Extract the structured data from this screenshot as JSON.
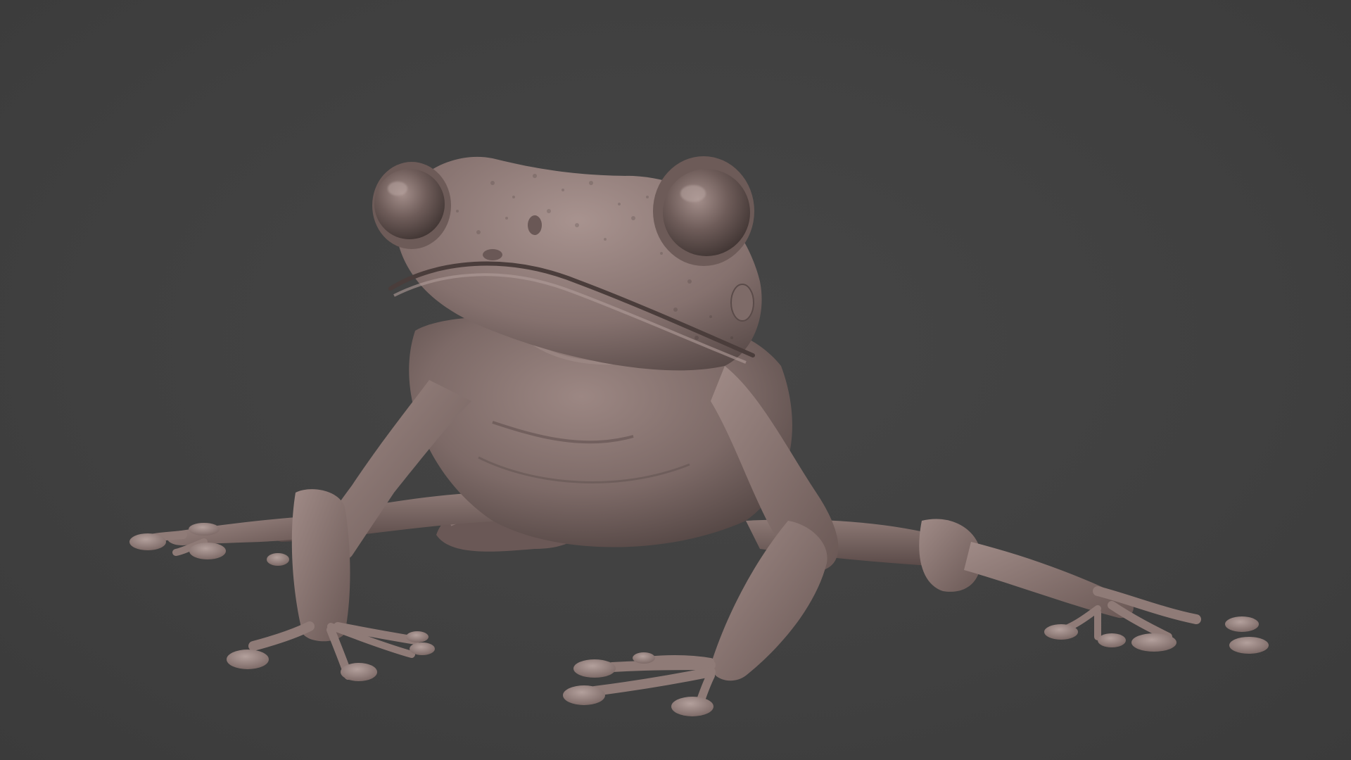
{
  "viewport": {
    "background_color": "#414141",
    "subject": "frog-sculpt",
    "material_color": "#8a7673",
    "material_shadow_color": "#4f4240",
    "material_highlight_color": "#b9a6a2"
  }
}
